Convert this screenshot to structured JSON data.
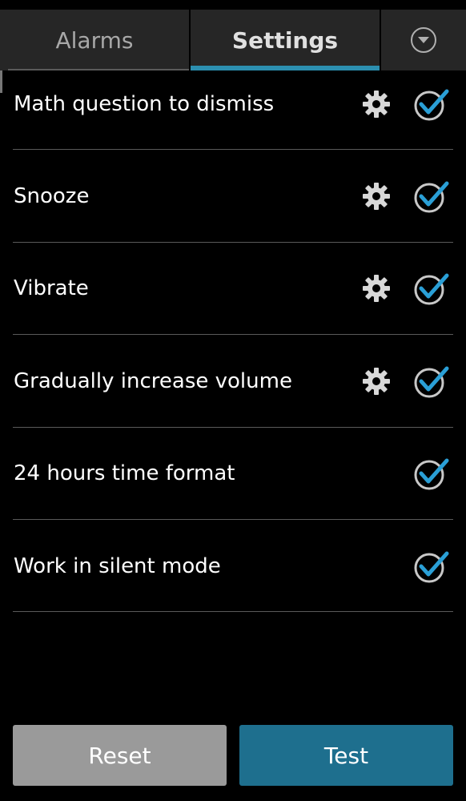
{
  "tabs": {
    "alarms_label": "Alarms",
    "settings_label": "Settings",
    "active": "Settings"
  },
  "settings": [
    {
      "label": "Math question to dismiss",
      "has_gear": true,
      "checked": true
    },
    {
      "label": "Snooze",
      "has_gear": true,
      "checked": true
    },
    {
      "label": "Vibrate",
      "has_gear": true,
      "checked": true
    },
    {
      "label": "Gradually increase volume",
      "has_gear": true,
      "checked": true
    },
    {
      "label": "24 hours time format",
      "has_gear": false,
      "checked": true
    },
    {
      "label": "Work in silent mode",
      "has_gear": false,
      "checked": true
    }
  ],
  "buttons": {
    "reset_label": "Reset",
    "test_label": "Test"
  },
  "colors": {
    "accent": "#2c8fb0",
    "check_blue": "#2a9fd6",
    "test_button": "#1e6f8e",
    "reset_button": "#9a9a9a"
  },
  "icons": {
    "menu": "dropdown-circle-icon",
    "settings": "gear-icon",
    "checkbox": "check-circle-icon"
  }
}
